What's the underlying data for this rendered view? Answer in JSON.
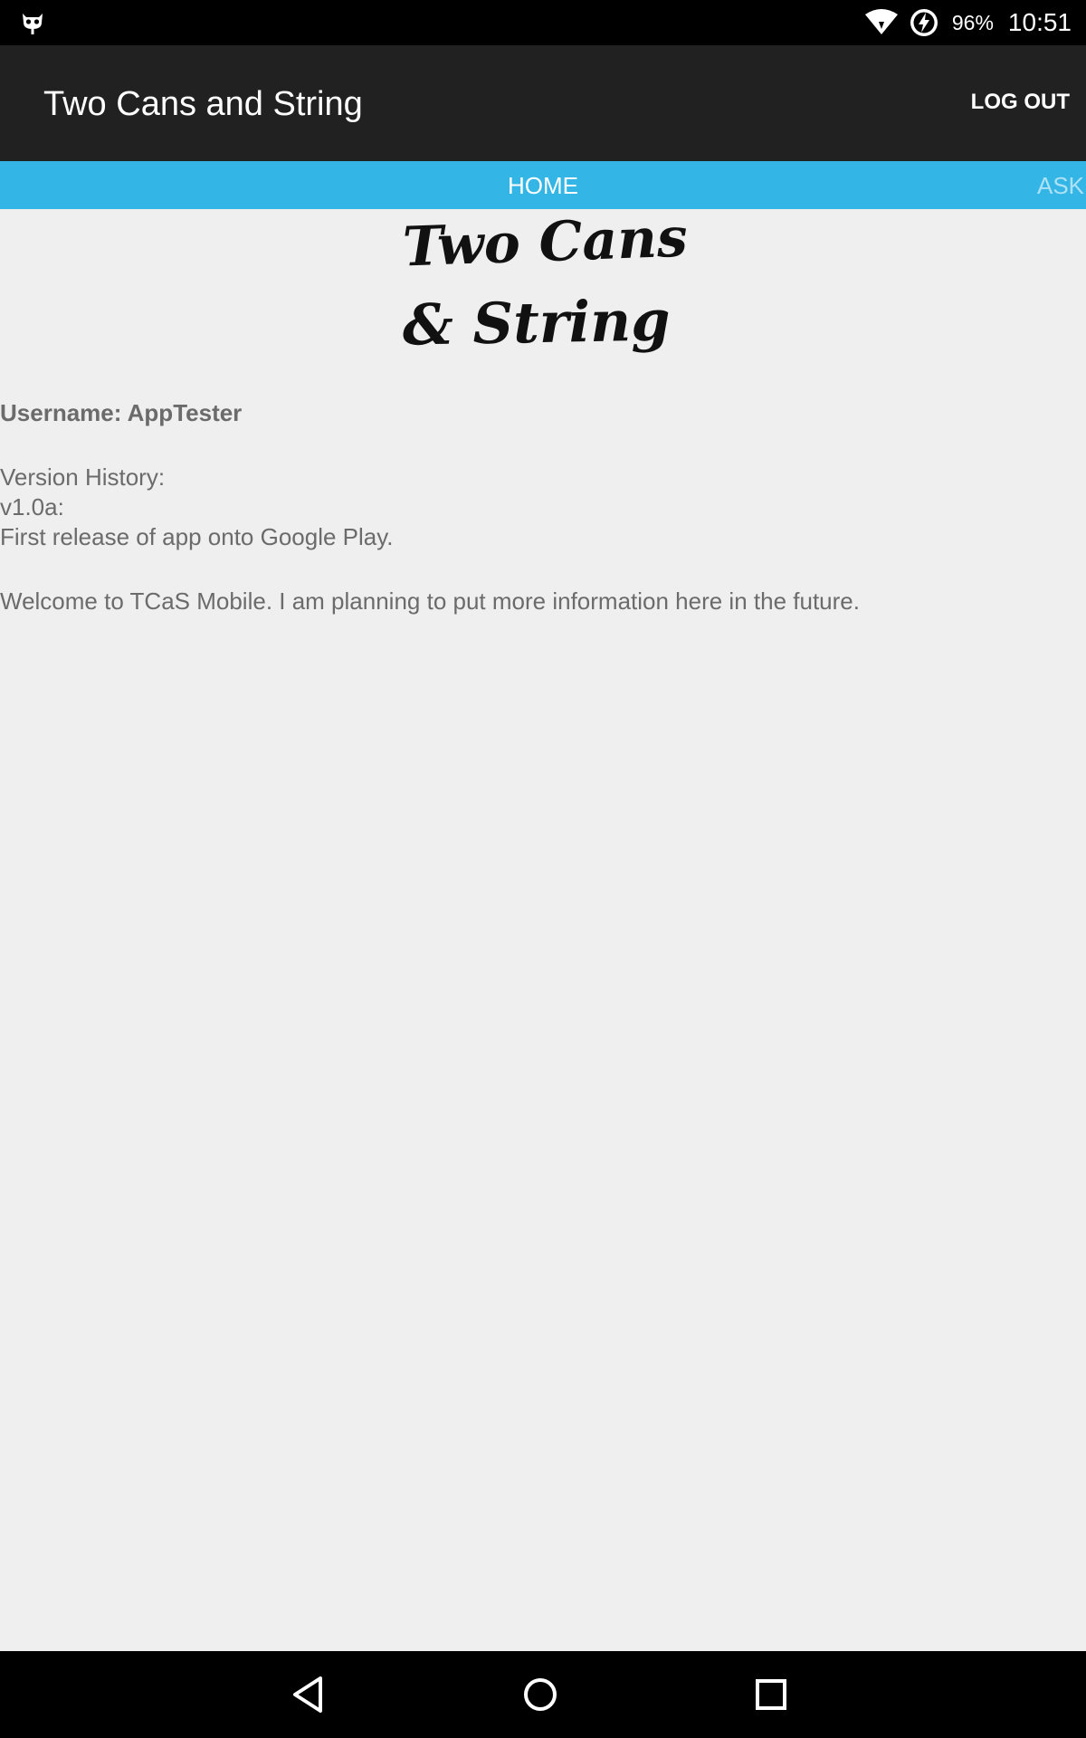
{
  "status_bar": {
    "notification_icon": "cyanogen-mod-icon",
    "wifi_icon": "wifi-icon",
    "battery_icon": "battery-charging-icon",
    "battery_percent": "96%",
    "time": "10:51"
  },
  "app_bar": {
    "title": "Two Cans and String",
    "logout_label": "LOG OUT"
  },
  "tabs": [
    {
      "label": "HOME",
      "selected": true
    },
    {
      "label": "ASK",
      "selected": false
    }
  ],
  "logo": {
    "line1": "Two Cans",
    "line2": "& String"
  },
  "content": {
    "username": "Username: AppTester",
    "version_header": "Version History:",
    "version": "v1.0a:",
    "version_note": "First release of app onto Google Play.",
    "welcome": "Welcome to TCaS Mobile. I am planning to put more information here in the future."
  },
  "nav_bar": {
    "back_icon": "back-icon",
    "home_icon": "home-icon",
    "recents_icon": "recents-icon"
  },
  "colors": {
    "app_bar": "#212121",
    "tab_strip": "#33b5e5",
    "background": "#efefef",
    "text": "#6b6b6b"
  }
}
